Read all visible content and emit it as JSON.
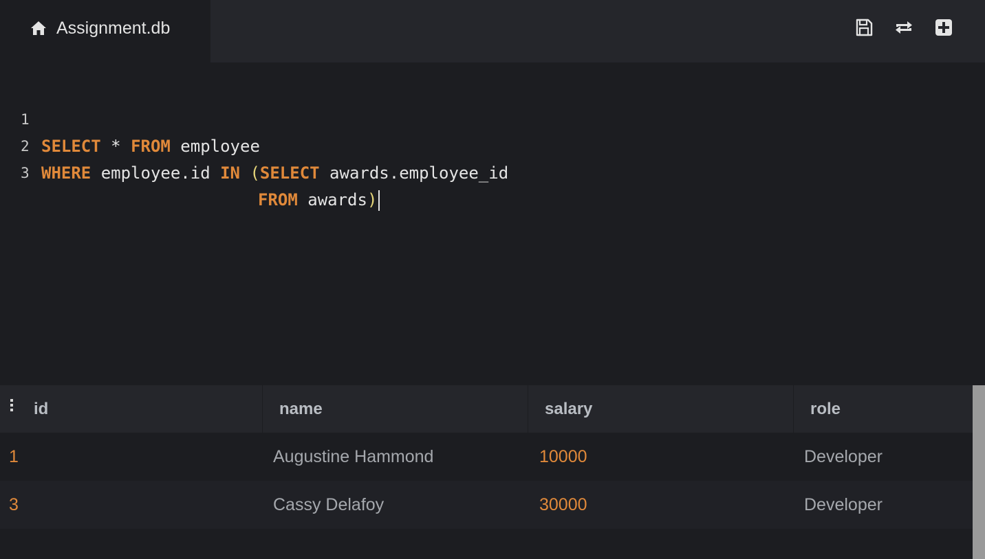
{
  "tab": {
    "title": "Assignment.db",
    "icon": "home-icon"
  },
  "toolbar": {
    "save_icon": "save-icon",
    "refresh_icon": "refresh-icon",
    "add_icon": "add-icon"
  },
  "editor": {
    "lines": [
      {
        "number": "1"
      },
      {
        "number": "2"
      },
      {
        "number": "3"
      }
    ],
    "tokens": {
      "l1_select": "SELECT",
      "l1_star": " * ",
      "l1_from": "FROM",
      "l1_table": " employee",
      "l2_where": "WHERE",
      "l2_col": " employee.id ",
      "l2_in": "IN",
      "l2_space": " ",
      "l2_paren": "(",
      "l2_select": "SELECT",
      "l2_sub": " awards.employee_id",
      "l3_from": "FROM",
      "l3_table": " awards",
      "l3_paren": ")"
    }
  },
  "results": {
    "columns": [
      "id",
      "name",
      "salary",
      "role"
    ],
    "rows": [
      [
        "1",
        "Augustine Hammond",
        "10000",
        "Developer"
      ],
      [
        "3",
        "Cassy Delafoy",
        "30000",
        "Developer"
      ]
    ]
  },
  "colors": {
    "keyword": "#e0893a",
    "paren": "#e6d67a",
    "text": "#e4e4e4",
    "number": "#e0893a",
    "muted": "#a5a8ad",
    "background": "#1c1d21",
    "panel": "#25262b"
  }
}
